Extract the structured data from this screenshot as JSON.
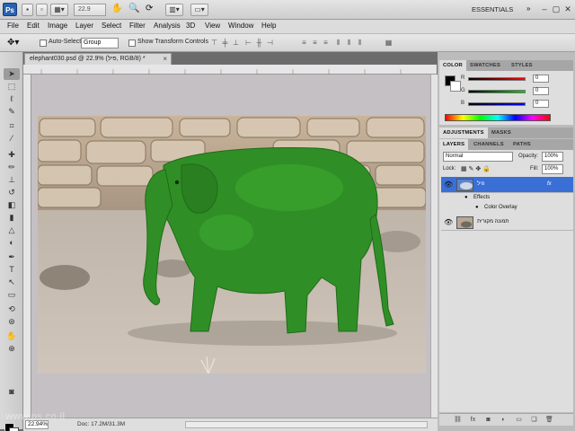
{
  "app": {
    "logo": "Ps",
    "zoom": "22.9",
    "workspace": "ESSENTIALS",
    "window_controls": [
      "–",
      "▢",
      "✕"
    ]
  },
  "menu": [
    "File",
    "Edit",
    "Image",
    "Layer",
    "Select",
    "Filter",
    "Analysis",
    "3D",
    "View",
    "Window",
    "Help"
  ],
  "options_bar": {
    "auto_select_label": "Auto-Select:",
    "auto_select_value": "Group",
    "transform_label": "Show Transform Controls"
  },
  "document": {
    "tab_title": "elephant030.psd @ 22.9% (פיל, RGB/8) *",
    "close": "×",
    "status_zoom": "22.94%",
    "status_doc": "Doc: 17.2M/31.3M"
  },
  "color_panel": {
    "tabs": [
      "COLOR",
      "SWATCHES",
      "STYLES"
    ],
    "active_tab": "COLOR",
    "channels": [
      {
        "label": "R",
        "value": "0",
        "gradient": "#ff0000"
      },
      {
        "label": "G",
        "value": "0",
        "gradient": "#00cc00"
      },
      {
        "label": "B",
        "value": "0",
        "gradient": "#0000ff"
      }
    ]
  },
  "adjust_panel": {
    "tabs": [
      "ADJUSTMENTS",
      "MASKS"
    ],
    "active_tab": "ADJUSTMENTS"
  },
  "layers_panel": {
    "tabs": [
      "LAYERS",
      "CHANNELS",
      "PATHS"
    ],
    "active_tab": "LAYERS",
    "blend_mode": "Normal",
    "opacity_label": "Opacity:",
    "opacity": "100%",
    "lock_label": "Lock:",
    "fill_label": "Fill:",
    "fill": "100%",
    "layers": [
      {
        "name": "פיל",
        "selected": true,
        "fx": "fx",
        "effects_label": "Effects",
        "effect": "Color Overlay"
      },
      {
        "name": "תמונה מקורית",
        "selected": false
      }
    ]
  },
  "colors": {
    "accent_selection": "#3a6fd6",
    "elephant_green": "#2f8f26"
  },
  "watermark": "www.ps.co.il"
}
